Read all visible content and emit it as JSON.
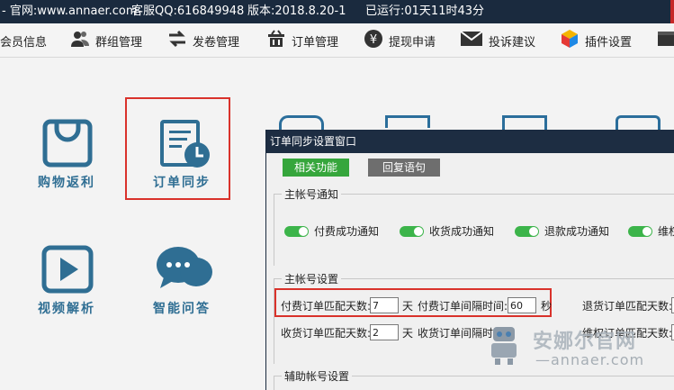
{
  "titlebar": {
    "site": "- 官网:www.annaer.com",
    "qq": "客服QQ:616849948",
    "version": "版本:2018.8.20-1",
    "uptime": "已运行:01天11时43分"
  },
  "toolbar": {
    "items": [
      {
        "label": "会员信息"
      },
      {
        "label": "群组管理"
      },
      {
        "label": "发卷管理"
      },
      {
        "label": "订单管理"
      },
      {
        "label": "提现申请"
      },
      {
        "label": "投诉建议"
      },
      {
        "label": "插件设置"
      }
    ]
  },
  "grid": {
    "items": [
      {
        "label": "购物返利"
      },
      {
        "label": "订单同步"
      },
      {
        "label": "视频解析"
      },
      {
        "label": "智能问答"
      }
    ]
  },
  "dialog": {
    "title": "订单同步设置窗口",
    "tabs": {
      "active": "相关功能",
      "inactive": "回复语句"
    },
    "main_notify": {
      "title": "主帐号通知",
      "toggles": [
        "付费成功通知",
        "收货成功通知",
        "退款成功通知",
        "维权"
      ]
    },
    "main_settings": {
      "title": "主帐号设置",
      "paid_match_days_label": "付费订单匹配天数:",
      "paid_match_days_value": "7",
      "day_unit": "天",
      "paid_interval_label": "付费订单间隔时间:",
      "paid_interval_value": "60",
      "second_unit": "秒",
      "refund_match_days_label": "退货订单匹配天数:",
      "receipt_match_days_label": "收货订单匹配天数:",
      "receipt_match_days_value": "2",
      "receipt_interval_label": "收货订单间隔时",
      "safeguard_match_days_label": "维权订单匹配天数:"
    },
    "aux_settings": {
      "title": "辅助帐号设置"
    }
  },
  "watermark": {
    "text": "安娜尔官网",
    "url": "—annaer.com"
  },
  "colors": {
    "accent_blue": "#2f6e93",
    "highlight_red": "#d9322b",
    "toggle_green": "#3cb44a",
    "titlebar": "#1a2a3e"
  }
}
